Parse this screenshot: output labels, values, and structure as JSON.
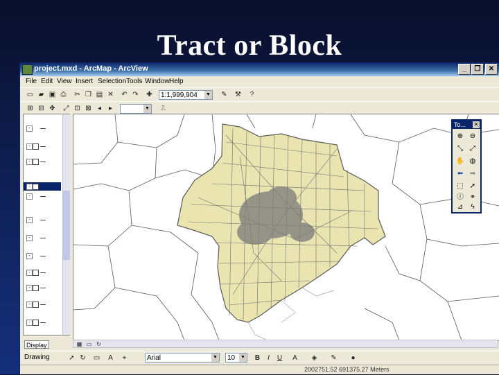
{
  "slide": {
    "title": "Tract or Block"
  },
  "window": {
    "title": "project.mxd - ArcMap - ArcView",
    "buttons": {
      "minimize": "_",
      "restore": "❐",
      "close": "✕"
    }
  },
  "menu": [
    "File",
    "Edit",
    "View",
    "Insert",
    "Selection",
    "Tools",
    "Window",
    "Help"
  ],
  "toolbar": {
    "scale": "1:1,999,904"
  },
  "toc": {
    "tab_display": "Display"
  },
  "tools_palette": {
    "title": "To..."
  },
  "drawing": {
    "label": "Drawing",
    "font": "Arial",
    "size": "10",
    "bold": "B",
    "italic": "I",
    "underline": "U"
  },
  "status": {
    "coordinates": "2002751.52  691375.27 Meters"
  },
  "colors": {
    "county_fill": "#e9e4b0",
    "tract_line": "#6e6e6e",
    "boundary_line": "#404040",
    "title_bar": "#0a246a"
  }
}
